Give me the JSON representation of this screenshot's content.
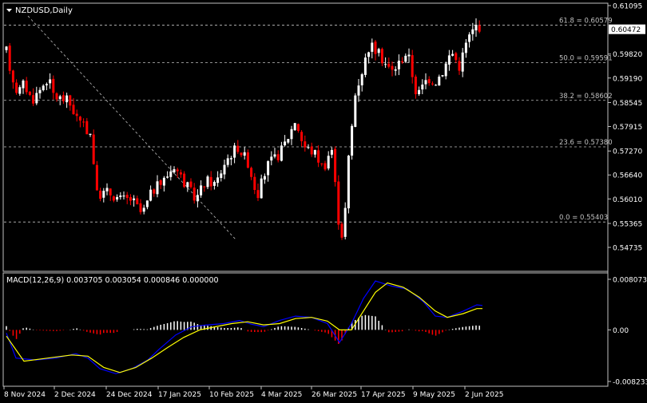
{
  "main_chart": {
    "symbol": "NZDUSD,Daily",
    "price_scale": [
      "0.61095",
      "0.59820",
      "0.59190",
      "0.58545",
      "0.57915",
      "0.57270",
      "0.56640",
      "0.56010",
      "0.55365",
      "0.54735"
    ],
    "current_price": "0.60472",
    "fib_levels": [
      {
        "label": "61.8 = 0.60579",
        "price": 0.60579
      },
      {
        "label": "50.0 = 0.59591",
        "price": 0.59591
      },
      {
        "label": "38.2 = 0.58602",
        "price": 0.58602
      },
      {
        "label": "23.6 = 0.57380",
        "price": 0.5738
      },
      {
        "label": "0.0 = 0.55403",
        "price": 0.55403
      }
    ]
  },
  "macd_panel": {
    "title": "MACD(12,26,9) 0.003705 0.003054 0.000846 0.000000",
    "scale": [
      "0.008073",
      "0.00",
      "-0.008233"
    ]
  },
  "x_axis": {
    "labels": [
      "8 Nov 2024",
      "2 Dec 2024",
      "24 Dec 2024",
      "17 Jan 2025",
      "10 Feb 2025",
      "4 Mar 2025",
      "26 Mar 2025",
      "17 Apr 2025",
      "9 May 2025",
      "2 Jun 2025"
    ]
  },
  "colors": {
    "bull": "#ffffff",
    "bear": "#ff0000",
    "grid": "#c0c0c0",
    "macd_signal": "#ffff00",
    "macd_line": "#0000ff",
    "background": "#000000"
  },
  "chart_data": [
    {
      "type": "candlestick",
      "title": "NZDUSD,Daily",
      "ylim": [
        0.54735,
        0.61095
      ],
      "x_labels": [
        "8 Nov 2024",
        "2 Dec 2024",
        "24 Dec 2024",
        "17 Jan 2025",
        "10 Feb 2025",
        "4 Mar 2025",
        "26 Mar 2025",
        "17 Apr 2025",
        "9 May 2025",
        "2 Jun 2025"
      ],
      "key_points": [
        {
          "date": "8 Nov 2024",
          "close": 0.595
        },
        {
          "date": "2 Dec 2024",
          "close": 0.589
        },
        {
          "date": "24 Dec 2024",
          "close": 0.559
        },
        {
          "date": "17 Jan 2025",
          "close": 0.564
        },
        {
          "date": "10 Feb 2025",
          "close": 0.566
        },
        {
          "date": "4 Mar 2025",
          "close": 0.58
        },
        {
          "date": "26 Mar 2025",
          "close": 0.548
        },
        {
          "date": "17 Apr 2025",
          "close": 0.595
        },
        {
          "date": "9 May 2025",
          "close": 0.589
        },
        {
          "date": "2 Jun 2025",
          "close": 0.6047
        }
      ],
      "last_price": 0.60472
    },
    {
      "type": "histogram+line",
      "title": "MACD(12,26,9) 0.003705 0.003054 0.000846 0.000000",
      "ylim": [
        -0.008233,
        0.008073
      ]
    }
  ]
}
